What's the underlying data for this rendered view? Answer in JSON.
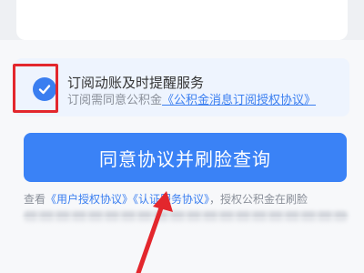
{
  "subscription": {
    "title": "订阅动账及时提醒服务",
    "desc_prefix": "订阅需同意公积金",
    "desc_link": "《公积金消息订阅授权协议》",
    "checked": true
  },
  "agree_button": {
    "label": "同意协议并刷脸查询"
  },
  "note": {
    "prefix": "查看",
    "link1": "《用户授权协议》",
    "link2": "《认证服务协议》",
    "suffix": "，授权公积金在刷脸"
  },
  "colors": {
    "accent": "#3a82f6",
    "checkbox": "#3a7ef0",
    "annotation": "#e3272d"
  },
  "icons": {
    "checkbox": "check-icon",
    "annotation": "arrow-up-icon"
  }
}
